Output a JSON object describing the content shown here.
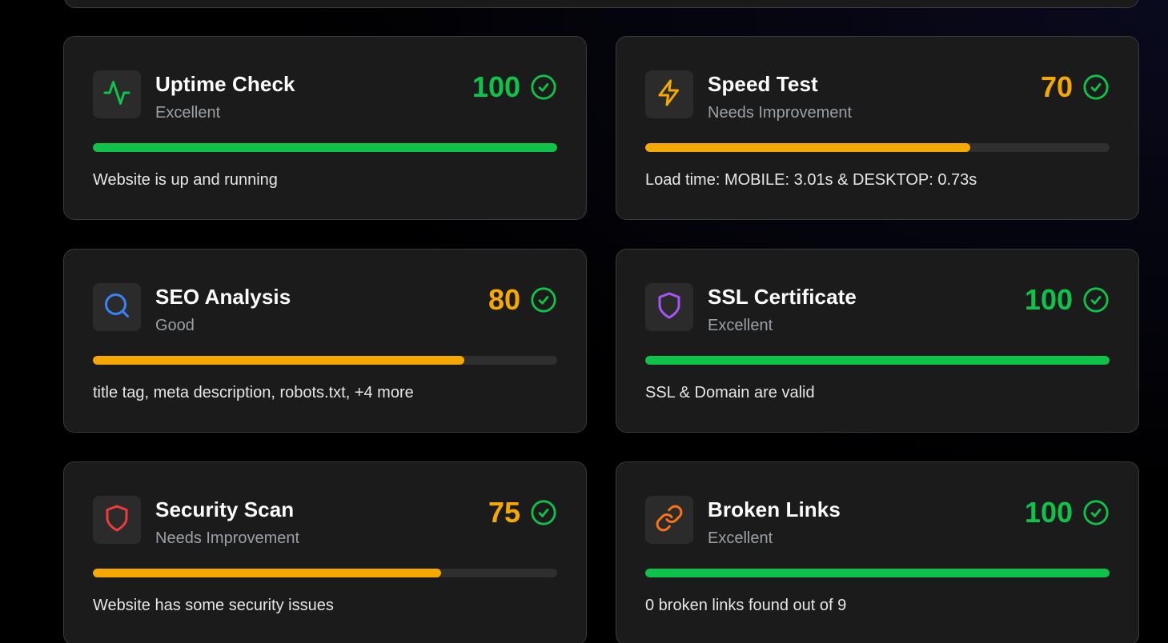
{
  "colors": {
    "excellent": "#0fc24a",
    "warning": "#f5a800",
    "track": "#2f2f2f"
  },
  "cards": [
    {
      "title": "Uptime Check",
      "status": "Excellent",
      "score": "100",
      "progress": 100,
      "detail": "Website is up and running",
      "icon": "activity-icon",
      "icon_color": "#0fc24a",
      "score_color": "#0fc24a",
      "bar_color": "#0fc24a"
    },
    {
      "title": "Speed Test",
      "status": "Needs Improvement",
      "score": "70",
      "progress": 70,
      "detail": "Load time: MOBILE: 3.01s & DESKTOP: 0.73s",
      "icon": "lightning-icon",
      "icon_color": "#f5a800",
      "score_color": "#f5a800",
      "bar_color": "#f5a800"
    },
    {
      "title": "SEO Analysis",
      "status": "Good",
      "score": "80",
      "progress": 80,
      "detail": "title tag, meta description, robots.txt, +4 more",
      "icon": "search-icon",
      "icon_color": "#3b82f6",
      "score_color": "#f5a800",
      "bar_color": "#f5a800"
    },
    {
      "title": "SSL Certificate",
      "status": "Excellent",
      "score": "100",
      "progress": 100,
      "detail": "SSL & Domain are valid",
      "icon": "shield-icon",
      "icon_color": "#a855f7",
      "score_color": "#0fc24a",
      "bar_color": "#0fc24a"
    },
    {
      "title": "Security Scan",
      "status": "Needs Improvement",
      "score": "75",
      "progress": 75,
      "detail": "Website has some security issues",
      "icon": "shield-alert-icon",
      "icon_color": "#ef3b3b",
      "score_color": "#f5a800",
      "bar_color": "#f5a800"
    },
    {
      "title": "Broken Links",
      "status": "Excellent",
      "score": "100",
      "progress": 100,
      "detail": "0 broken links found out of 9",
      "icon": "link-icon",
      "icon_color": "#f97316",
      "score_color": "#0fc24a",
      "bar_color": "#0fc24a"
    }
  ],
  "check_icon": "check-circle-icon",
  "check_color": "#0fc24a"
}
